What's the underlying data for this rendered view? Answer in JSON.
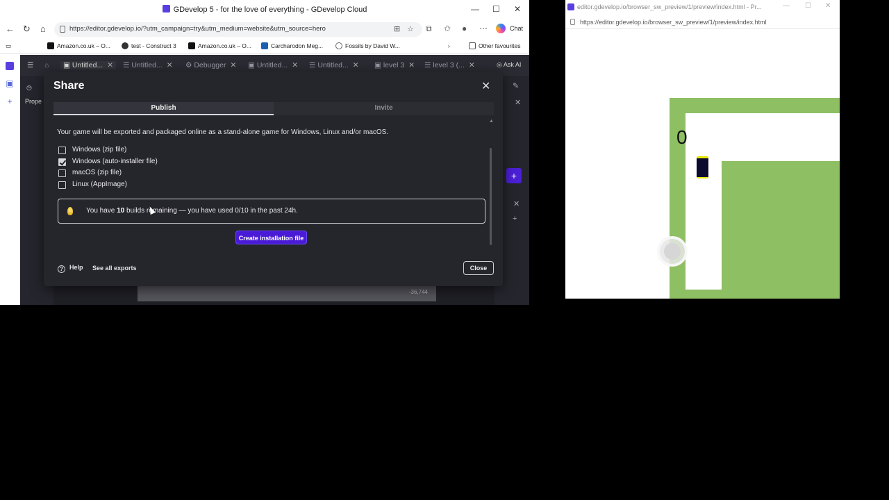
{
  "left_browser": {
    "title": "GDevelop 5 - for the love of everything - GDevelop Cloud",
    "url": "https://editor.gdevelop.io/?utm_campaign=try&utm_medium=website&utm_source=hero",
    "chat_label": "Chat",
    "favorites": [
      {
        "label": "Amazon.co.uk – O...",
        "color": "#111111"
      },
      {
        "label": "test - Construct 3",
        "color": "#333333"
      },
      {
        "label": "Amazon.co.uk – O...",
        "color": "#111111"
      },
      {
        "label": "Carcharodon Meg...",
        "color": "#1a5fb4"
      },
      {
        "label": "Fossils by David W...",
        "color": "#666666"
      }
    ],
    "other_favourites": "Other favourites"
  },
  "editor": {
    "tabs": [
      {
        "label": "Untitled...",
        "icon": "scene-icon"
      },
      {
        "label": "Untitled...",
        "icon": "events-icon"
      },
      {
        "label": "Debugger",
        "icon": "debugger-icon"
      },
      {
        "label": "Untitled...",
        "icon": "scene-icon"
      },
      {
        "label": "Untitled...",
        "icon": "events-icon"
      },
      {
        "label": "level 3",
        "icon": "scene-icon"
      },
      {
        "label": "level 3 (...",
        "icon": "events-icon"
      }
    ],
    "ask_ai": "Ask AI",
    "side_label": "Prope",
    "coords": "-36,744"
  },
  "share_dialog": {
    "title": "Share",
    "tabs": {
      "publish": "Publish",
      "invite": "Invite"
    },
    "description": "Your game will be exported and packaged online as a stand-alone game for Windows, Linux and/or macOS.",
    "options": [
      {
        "label": "Windows (zip file)",
        "checked": false
      },
      {
        "label": "Windows (auto-installer file)",
        "checked": true
      },
      {
        "label": "macOS (zip file)",
        "checked": false
      },
      {
        "label": "Linux (AppImage)",
        "checked": false
      }
    ],
    "builds_info": {
      "prefix": "You have ",
      "count": "10",
      "suffix": " builds remaining — you have used 0/10 in the past 24h."
    },
    "create_button": "Create installation file",
    "help": "Help",
    "see_all_exports": "See all exports",
    "close_button": "Close"
  },
  "preview_window": {
    "title": "editor.gdevelop.io/browser_sw_preview/1/preview/index.html - Pr...",
    "url": "https://editor.gdevelop.io/browser_sw_preview/1/preview/index.html",
    "score": "0"
  },
  "colors": {
    "accent": "#4a1bd6",
    "ground": "#8ebf63",
    "dialog_bg": "#25252c"
  }
}
